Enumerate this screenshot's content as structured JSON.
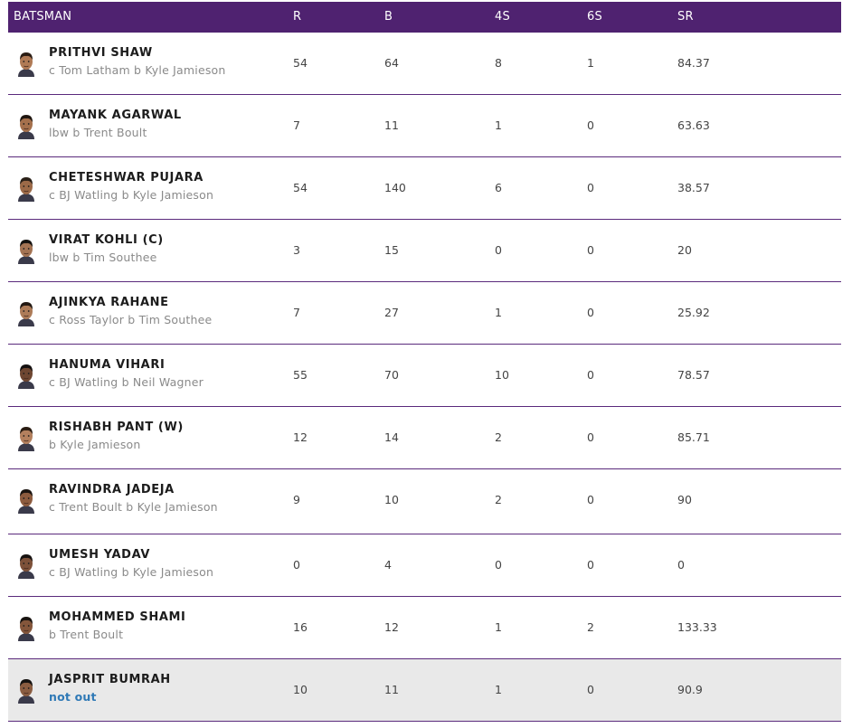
{
  "header": {
    "batsman": "BATSMAN",
    "r": "R",
    "b": "B",
    "fours": "4S",
    "sixes": "6S",
    "sr": "SR"
  },
  "colors": {
    "header_bg": "#4f2270",
    "row_divider": "#5a2a7c",
    "not_out": "#2f79b6",
    "highlight_row": "#e9e9e9"
  },
  "batsmen": [
    {
      "name": "PRITHVI SHAW",
      "dismissal": "c Tom Latham b Kyle Jamieson",
      "r": "54",
      "b": "64",
      "fours": "8",
      "sixes": "1",
      "sr": "84.37",
      "icon": "player-avatar-icon",
      "skin": "#b07a55",
      "hair": "#2b1d14"
    },
    {
      "name": "MAYANK AGARWAL",
      "dismissal": "lbw b Trent Boult",
      "r": "7",
      "b": "11",
      "fours": "1",
      "sixes": "0",
      "sr": "63.63",
      "icon": "player-avatar-icon",
      "skin": "#a5704c",
      "hair": "#1e1510"
    },
    {
      "name": "CHETESHWAR PUJARA",
      "dismissal": "c BJ Watling b Kyle Jamieson",
      "r": "54",
      "b": "140",
      "fours": "6",
      "sixes": "0",
      "sr": "38.57",
      "icon": "player-avatar-icon",
      "skin": "#9c6a48",
      "hair": "#2a2018"
    },
    {
      "name": "VIRAT KOHLI (C)",
      "dismissal": "lbw b Tim Southee",
      "r": "3",
      "b": "15",
      "fours": "0",
      "sixes": "0",
      "sr": "20",
      "icon": "player-avatar-icon",
      "skin": "#a47353",
      "hair": "#151210"
    },
    {
      "name": "AJINKYA RAHANE",
      "dismissal": "c Ross Taylor b Tim Southee",
      "r": "7",
      "b": "27",
      "fours": "1",
      "sixes": "0",
      "sr": "25.92",
      "icon": "player-avatar-icon",
      "skin": "#ad7b58",
      "hair": "#221812"
    },
    {
      "name": "HANUMA VIHARI",
      "dismissal": "c BJ Watling b Neil Wagner",
      "r": "55",
      "b": "70",
      "fours": "10",
      "sixes": "0",
      "sr": "78.57",
      "icon": "player-avatar-icon",
      "skin": "#6e4631",
      "hair": "#141010"
    },
    {
      "name": "RISHABH PANT (W)",
      "dismissal": "b Kyle Jamieson",
      "r": "12",
      "b": "14",
      "fours": "2",
      "sixes": "0",
      "sr": "85.71",
      "icon": "player-avatar-icon",
      "skin": "#b3805e",
      "hair": "#2a1c12"
    },
    {
      "name": "RAVINDRA JADEJA",
      "dismissal": "c Trent Boult b Kyle Jamieson",
      "r": "9",
      "b": "10",
      "fours": "2",
      "sixes": "0",
      "sr": "90",
      "icon": "player-avatar-icon",
      "skin": "#8d5b3e",
      "hair": "#1b1410"
    },
    {
      "name": "UMESH YADAV",
      "dismissal": "c BJ Watling b Kyle Jamieson",
      "r": "0",
      "b": "4",
      "fours": "0",
      "sixes": "0",
      "sr": "0",
      "icon": "player-avatar-icon",
      "skin": "#7d5139",
      "hair": "#161210"
    },
    {
      "name": "MOHAMMED SHAMI",
      "dismissal": "b Trent Boult",
      "r": "16",
      "b": "12",
      "fours": "1",
      "sixes": "2",
      "sr": "133.33",
      "icon": "player-avatar-icon",
      "skin": "#84563b",
      "hair": "#181310"
    },
    {
      "name": "JASPRIT BUMRAH",
      "dismissal": "not out",
      "not_out": true,
      "r": "10",
      "b": "11",
      "fours": "1",
      "sixes": "0",
      "sr": "90.9",
      "icon": "player-avatar-icon",
      "skin": "#8a5c40",
      "hair": "#151210"
    }
  ]
}
